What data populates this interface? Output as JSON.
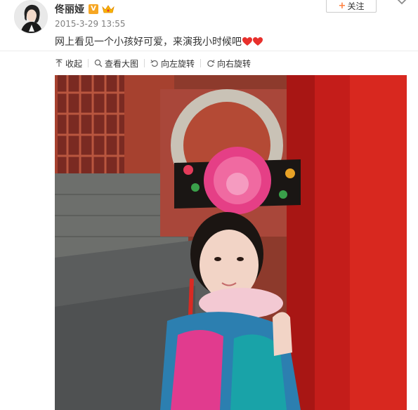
{
  "author": {
    "name": "佟丽娅",
    "verified_badge": "V",
    "brand_color": "#f6a623"
  },
  "post": {
    "timestamp": "2015-3-29 13:55",
    "text": "网上看见一个小孩好可爱，来演我小时候吧"
  },
  "actions": {
    "follow_label": "关注"
  },
  "toolbar": {
    "collapse_label": "收起",
    "view_large_label": "查看大图",
    "rotate_left_label": "向左旋转",
    "rotate_right_label": "向右旋转"
  },
  "icons": {
    "hearts": [
      "heart-icon",
      "heart-icon"
    ],
    "follow": "plus-icon",
    "more": "chevron-down-icon"
  },
  "colors": {
    "accent": "#ff8140",
    "heart": "#e8302c",
    "text": "#333333",
    "muted": "#808080"
  }
}
